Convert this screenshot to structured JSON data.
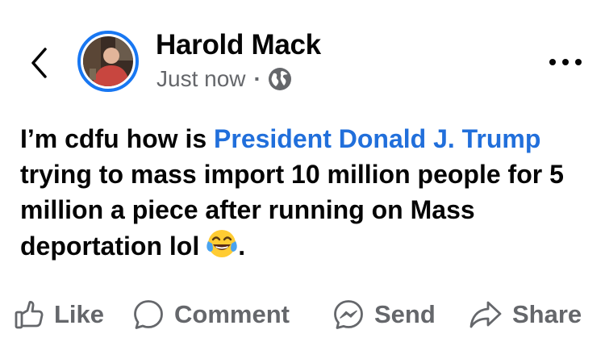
{
  "post": {
    "author": "Harold Mack",
    "timestamp": "Just now",
    "separator": "·",
    "privacy_icon": "globe-icon",
    "text_before": "I’m cdfu how is ",
    "mention": "President Donald J. Trump",
    "text_after": " trying to mass import 10 million people for 5 million a piece after running on Mass deportation lol",
    "emoji": "😂",
    "emoji_icon": "face-with-tears-of-joy-icon",
    "text_end": "."
  },
  "actions": {
    "like_label": "Like",
    "comment_label": "Comment",
    "send_label": "Send",
    "share_label": "Share"
  },
  "colors": {
    "accent": "#1877f2",
    "mention": "#216fdb",
    "text": "#050505",
    "secondary": "#65676b"
  }
}
